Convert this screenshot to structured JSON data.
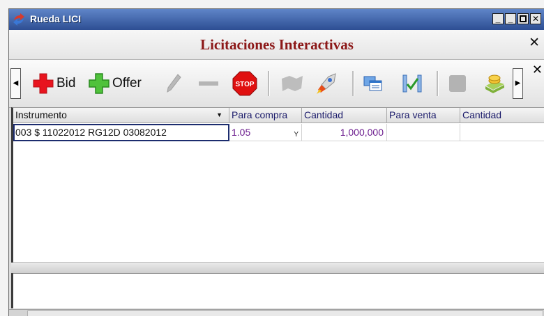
{
  "window": {
    "title": "Rueda LICI",
    "minimize_glyph": "_",
    "restore_glyph": "▫",
    "close_glyph": "✕"
  },
  "header": {
    "title": "Licitaciones Interactivas",
    "close_glyph": "✕"
  },
  "toolbar": {
    "scroll_left_glyph": "◀",
    "scroll_right_glyph": "▶",
    "close_glyph": "✕",
    "bid_label": "Bid",
    "offer_label": "Offer",
    "icons": [
      "bid-plus-icon",
      "offer-plus-icon",
      "edit-pen-icon",
      "remove-minus-icon",
      "stop-icon",
      "map-icon",
      "rocket-icon",
      "windows-icon",
      "chart-check-icon",
      "square-icon",
      "coins-icon"
    ],
    "stop_text": "STOP"
  },
  "grid": {
    "columns": [
      "Instrumento",
      "Para compra",
      "Cantidad",
      "Para venta",
      "Cantidad"
    ],
    "sort_glyph": "▼",
    "rows": [
      {
        "instrumento": "003 $ 11022012 RG12D 03082012",
        "para_compra": "1.05",
        "para_compra_flag": "Y",
        "cantidad_compra": "1,000,000",
        "para_venta": "",
        "cantidad_venta": ""
      }
    ]
  },
  "colors": {
    "titlebar": "#2d4e93",
    "header_title": "#8c1818",
    "value_text": "#6c1d8e",
    "bid_red": "#e8141e",
    "offer_green": "#2fa82a"
  }
}
